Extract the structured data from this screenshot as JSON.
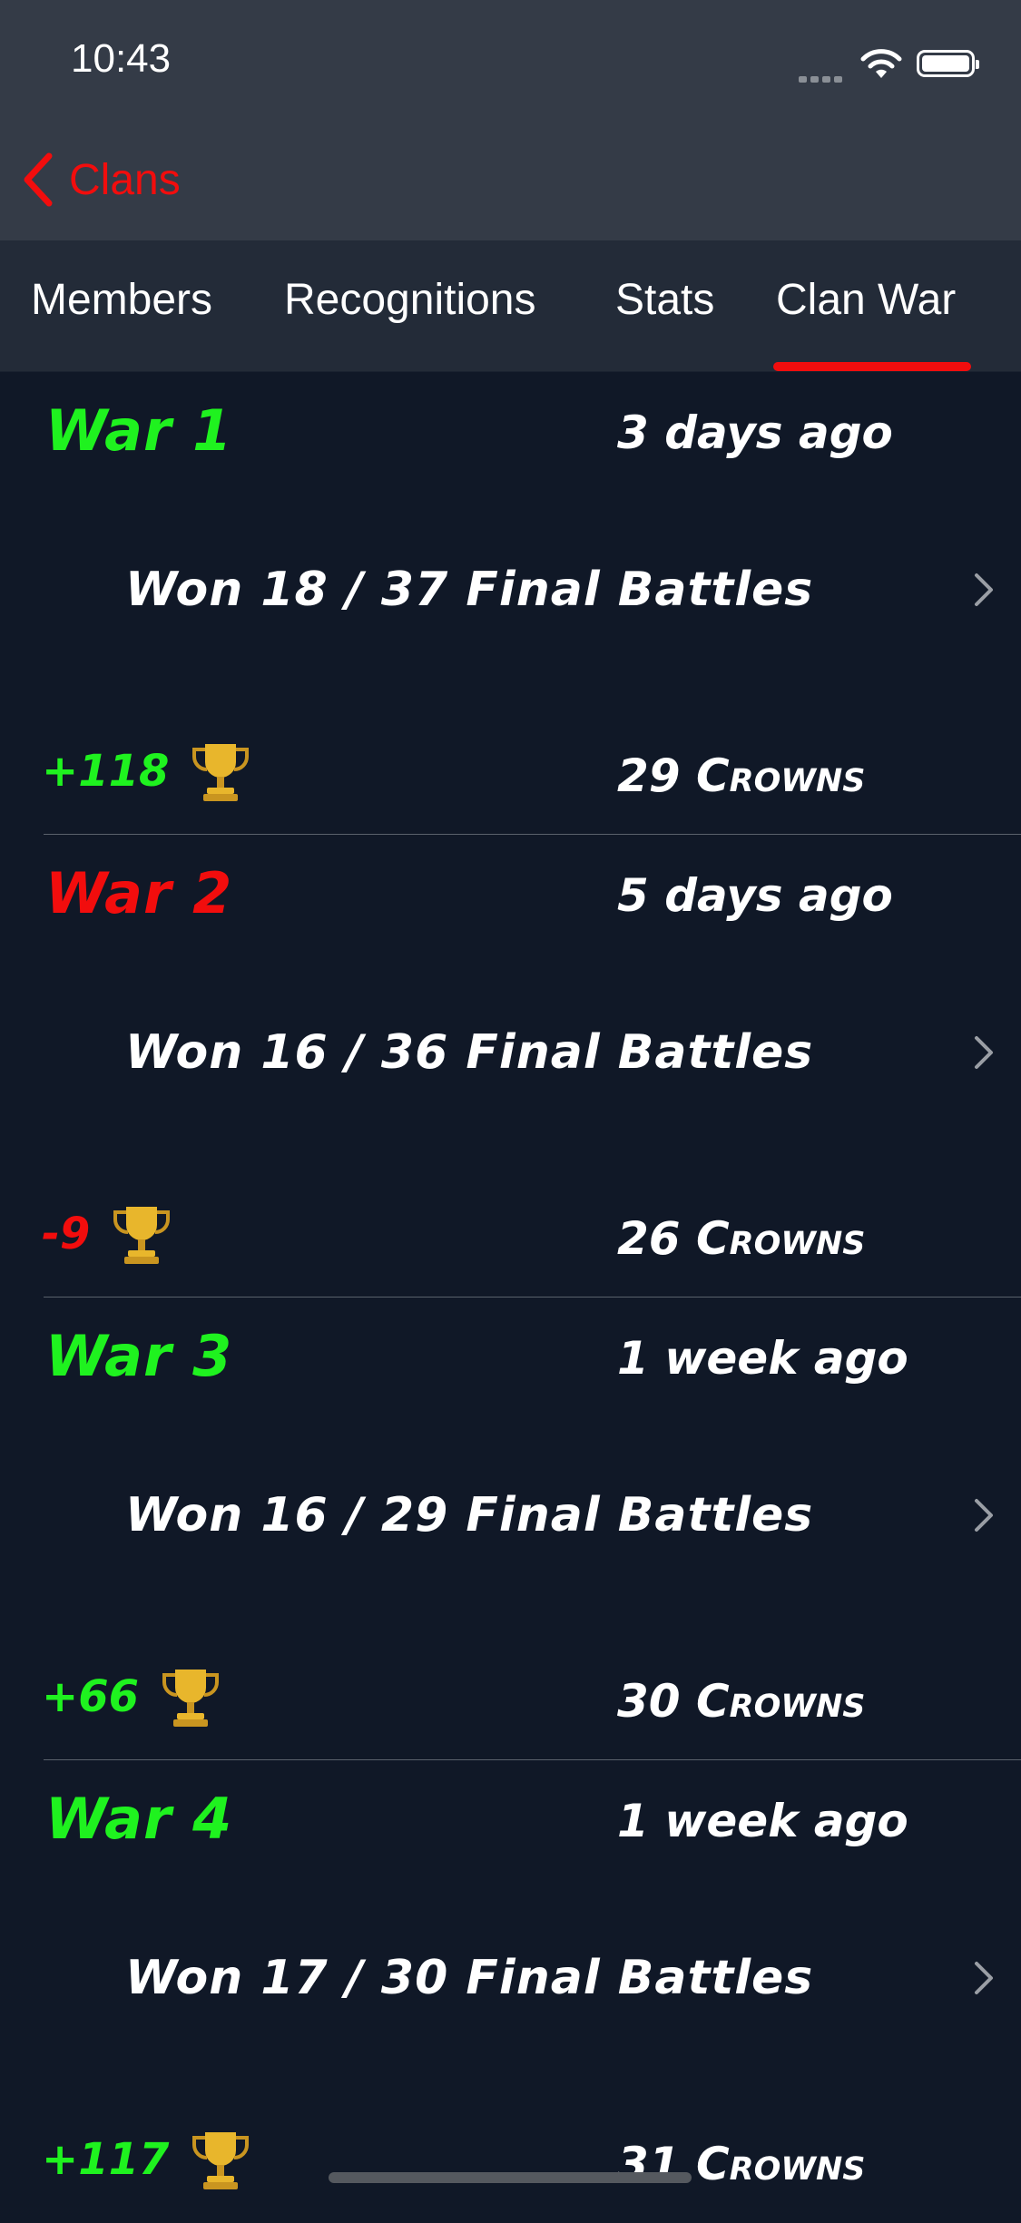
{
  "status_bar": {
    "time": "10:43"
  },
  "nav": {
    "back_label": "Clans"
  },
  "tabs": [
    {
      "label": "Members"
    },
    {
      "label": "Recognitions"
    },
    {
      "label": "Stats"
    },
    {
      "label": "Clan War",
      "selected": true
    }
  ],
  "colors": {
    "accent": "#f20d0d",
    "positive": "#1ff21f",
    "background": "#101827"
  },
  "wars": [
    {
      "title": "War 1",
      "ago": "3 days ago",
      "battles": "Won 18 / 37 Final Battles",
      "trophy_delta": "+118",
      "crowns": "29 Crowns",
      "status": "positive"
    },
    {
      "title": "War 2",
      "ago": "5 days ago",
      "battles": "Won 16 / 36 Final Battles",
      "trophy_delta": "-9",
      "crowns": "26 Crowns",
      "status": "negative"
    },
    {
      "title": "War 3",
      "ago": "1 week ago",
      "battles": "Won 16 / 29 Final Battles",
      "trophy_delta": "+66",
      "crowns": "30 Crowns",
      "status": "positive"
    },
    {
      "title": "War 4",
      "ago": "1 week ago",
      "battles": "Won 17 / 30 Final Battles",
      "trophy_delta": "+117",
      "crowns": "31 Crowns",
      "status": "positive"
    }
  ],
  "icons": {
    "back": "chevron-left-icon",
    "row": "chevron-right-icon",
    "trophy": "trophy-icon",
    "wifi": "wifi-icon",
    "battery": "battery-icon",
    "signal": "cellular-signal-icon"
  }
}
